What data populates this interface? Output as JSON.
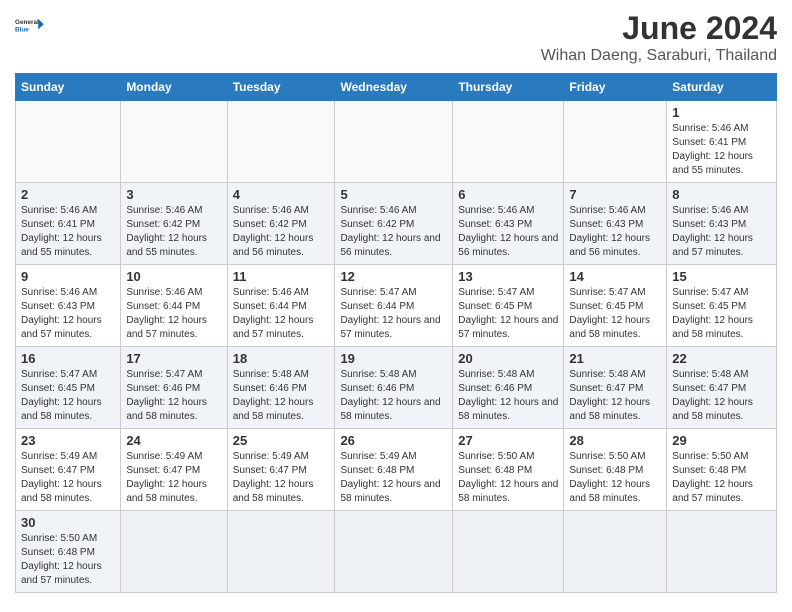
{
  "header": {
    "logo_general": "General",
    "logo_blue": "Blue",
    "title": "June 2024",
    "subtitle": "Wihan Daeng, Saraburi, Thailand"
  },
  "days_of_week": [
    "Sunday",
    "Monday",
    "Tuesday",
    "Wednesday",
    "Thursday",
    "Friday",
    "Saturday"
  ],
  "weeks": [
    [
      {
        "day": null
      },
      {
        "day": null
      },
      {
        "day": null
      },
      {
        "day": null
      },
      {
        "day": null
      },
      {
        "day": null
      },
      {
        "day": 1,
        "sunrise": "5:46 AM",
        "sunset": "6:41 PM",
        "daylight": "12 hours and 55 minutes."
      }
    ],
    [
      {
        "day": 2,
        "sunrise": "5:46 AM",
        "sunset": "6:41 PM",
        "daylight": "12 hours and 55 minutes."
      },
      {
        "day": 3,
        "sunrise": "5:46 AM",
        "sunset": "6:42 PM",
        "daylight": "12 hours and 55 minutes."
      },
      {
        "day": 4,
        "sunrise": "5:46 AM",
        "sunset": "6:42 PM",
        "daylight": "12 hours and 56 minutes."
      },
      {
        "day": 5,
        "sunrise": "5:46 AM",
        "sunset": "6:42 PM",
        "daylight": "12 hours and 56 minutes."
      },
      {
        "day": 6,
        "sunrise": "5:46 AM",
        "sunset": "6:43 PM",
        "daylight": "12 hours and 56 minutes."
      },
      {
        "day": 7,
        "sunrise": "5:46 AM",
        "sunset": "6:43 PM",
        "daylight": "12 hours and 56 minutes."
      },
      {
        "day": 8,
        "sunrise": "5:46 AM",
        "sunset": "6:43 PM",
        "daylight": "12 hours and 57 minutes."
      }
    ],
    [
      {
        "day": 9,
        "sunrise": "5:46 AM",
        "sunset": "6:43 PM",
        "daylight": "12 hours and 57 minutes."
      },
      {
        "day": 10,
        "sunrise": "5:46 AM",
        "sunset": "6:44 PM",
        "daylight": "12 hours and 57 minutes."
      },
      {
        "day": 11,
        "sunrise": "5:46 AM",
        "sunset": "6:44 PM",
        "daylight": "12 hours and 57 minutes."
      },
      {
        "day": 12,
        "sunrise": "5:47 AM",
        "sunset": "6:44 PM",
        "daylight": "12 hours and 57 minutes."
      },
      {
        "day": 13,
        "sunrise": "5:47 AM",
        "sunset": "6:45 PM",
        "daylight": "12 hours and 57 minutes."
      },
      {
        "day": 14,
        "sunrise": "5:47 AM",
        "sunset": "6:45 PM",
        "daylight": "12 hours and 58 minutes."
      },
      {
        "day": 15,
        "sunrise": "5:47 AM",
        "sunset": "6:45 PM",
        "daylight": "12 hours and 58 minutes."
      }
    ],
    [
      {
        "day": 16,
        "sunrise": "5:47 AM",
        "sunset": "6:45 PM",
        "daylight": "12 hours and 58 minutes."
      },
      {
        "day": 17,
        "sunrise": "5:47 AM",
        "sunset": "6:46 PM",
        "daylight": "12 hours and 58 minutes."
      },
      {
        "day": 18,
        "sunrise": "5:48 AM",
        "sunset": "6:46 PM",
        "daylight": "12 hours and 58 minutes."
      },
      {
        "day": 19,
        "sunrise": "5:48 AM",
        "sunset": "6:46 PM",
        "daylight": "12 hours and 58 minutes."
      },
      {
        "day": 20,
        "sunrise": "5:48 AM",
        "sunset": "6:46 PM",
        "daylight": "12 hours and 58 minutes."
      },
      {
        "day": 21,
        "sunrise": "5:48 AM",
        "sunset": "6:47 PM",
        "daylight": "12 hours and 58 minutes."
      },
      {
        "day": 22,
        "sunrise": "5:48 AM",
        "sunset": "6:47 PM",
        "daylight": "12 hours and 58 minutes."
      }
    ],
    [
      {
        "day": 23,
        "sunrise": "5:49 AM",
        "sunset": "6:47 PM",
        "daylight": "12 hours and 58 minutes."
      },
      {
        "day": 24,
        "sunrise": "5:49 AM",
        "sunset": "6:47 PM",
        "daylight": "12 hours and 58 minutes."
      },
      {
        "day": 25,
        "sunrise": "5:49 AM",
        "sunset": "6:47 PM",
        "daylight": "12 hours and 58 minutes."
      },
      {
        "day": 26,
        "sunrise": "5:49 AM",
        "sunset": "6:48 PM",
        "daylight": "12 hours and 58 minutes."
      },
      {
        "day": 27,
        "sunrise": "5:50 AM",
        "sunset": "6:48 PM",
        "daylight": "12 hours and 58 minutes."
      },
      {
        "day": 28,
        "sunrise": "5:50 AM",
        "sunset": "6:48 PM",
        "daylight": "12 hours and 58 minutes."
      },
      {
        "day": 29,
        "sunrise": "5:50 AM",
        "sunset": "6:48 PM",
        "daylight": "12 hours and 57 minutes."
      }
    ],
    [
      {
        "day": 30,
        "sunrise": "5:50 AM",
        "sunset": "6:48 PM",
        "daylight": "12 hours and 57 minutes."
      },
      {
        "day": null
      },
      {
        "day": null
      },
      {
        "day": null
      },
      {
        "day": null
      },
      {
        "day": null
      },
      {
        "day": null
      }
    ]
  ]
}
